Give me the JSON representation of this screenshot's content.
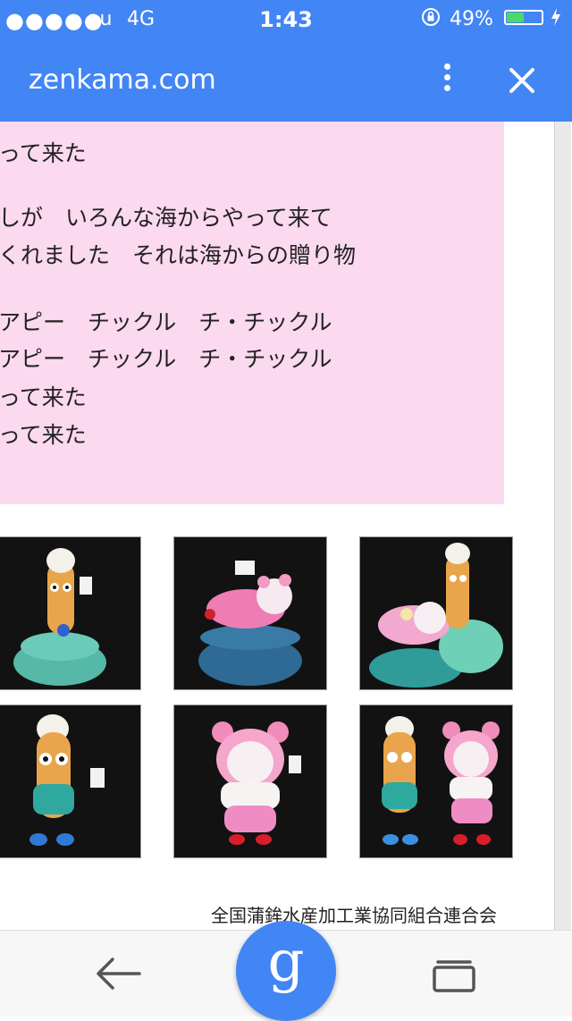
{
  "status_bar": {
    "signal": "●●●●●",
    "carrier": "au",
    "network": "4G",
    "time": "1:43",
    "battery_percent": "49%",
    "battery_level": 0.49,
    "icons": [
      "rotation-lock-icon",
      "battery-icon",
      "charging-icon"
    ]
  },
  "toolbar": {
    "url": "zenkama.com",
    "icons": [
      "more-vert-icon",
      "close-icon"
    ]
  },
  "lyrics": {
    "lines": [
      "って来た",
      "しが　いろんな海からやって来て",
      "くれました　それは海からの贈り物",
      "アピー　チックル　チ・チックル",
      "アピー　チックル　チ・チックル",
      "って来た",
      "って来た"
    ],
    "background": "#fbd9ee"
  },
  "photos": [
    {
      "name": "photo-chikuwa-character"
    },
    {
      "name": "photo-pink-bear-lying"
    },
    {
      "name": "photo-both-on-stands"
    },
    {
      "name": "photo-chikuwa-standing"
    },
    {
      "name": "photo-pink-bear-standing"
    },
    {
      "name": "photo-pair-holding-hands"
    }
  ],
  "footer": {
    "organization": "全国蒲鉾水産加工業協同組合連合会"
  },
  "bottom_bar": {
    "google_label": "g",
    "icons": [
      "back-arrow-icon",
      "google-icon",
      "tabs-icon"
    ]
  },
  "colors": {
    "accent": "#4285f4",
    "battery": "#4cd964"
  }
}
